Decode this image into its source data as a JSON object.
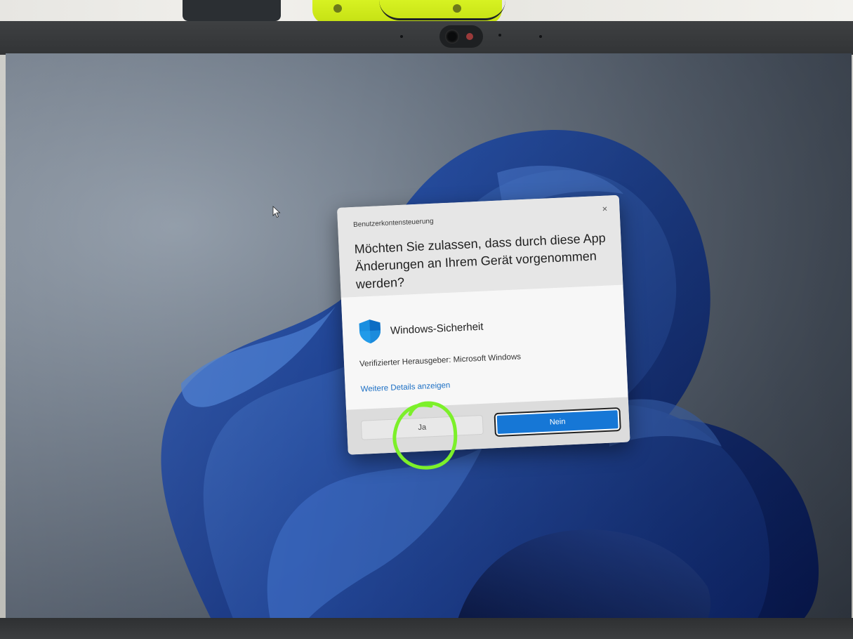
{
  "dialog": {
    "app_title": "Benutzerkontensteuerung",
    "close_symbol": "×",
    "question_line1": "Möchten Sie zulassen, dass durch diese App",
    "question_line2": "Änderungen an Ihrem Gerät vorgenommen",
    "question_line3": "werden?",
    "app_name": "Windows-Sicherheit",
    "app_icon": "windows-security-shield-icon",
    "publisher": "Verifizierter Herausgeber: Microsoft Windows",
    "details_link": "Weitere Details anzeigen",
    "yes_button": "Ja",
    "no_button": "Nein"
  },
  "colors": {
    "accent": "#1677d6",
    "link": "#1c6fc4",
    "annotation": "#7cf02a"
  }
}
